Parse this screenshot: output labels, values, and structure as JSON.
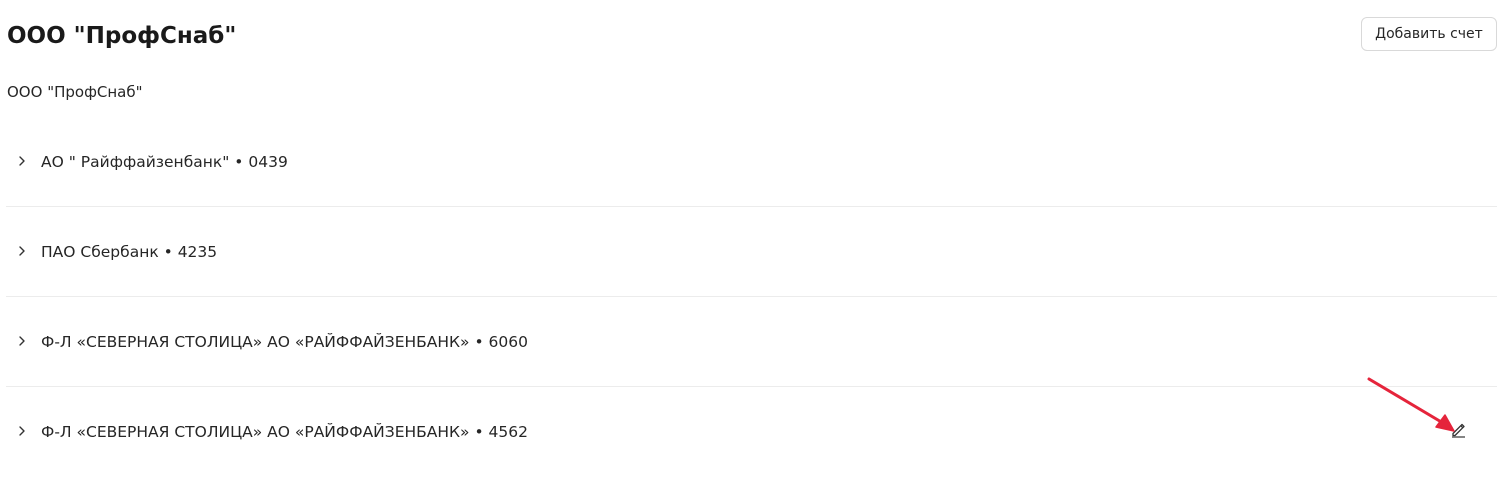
{
  "header": {
    "title": "ООО \"ПрофСнаб\"",
    "add_button_label": "Добавить счет"
  },
  "subtitle": "ООО \"ПрофСнаб\"",
  "accounts": [
    {
      "label": "АО \" Райффайзенбанк\" • 0439",
      "icon": "chevron-right-icon"
    },
    {
      "label": "ПАО Сбербанк • 4235",
      "icon": "chevron-right-icon"
    },
    {
      "label": "Ф-Л «СЕВЕРНАЯ СТОЛИЦА» АО «РАЙФФАЙЗЕНБАНК» • 6060",
      "icon": "chevron-right-icon"
    },
    {
      "label": "Ф-Л «СЕВЕРНАЯ СТОЛИЦА» АО «РАЙФФАЙЗЕНБАНК» • 4562",
      "icon": "chevron-right-icon",
      "action_icon": "pencil-edit-icon"
    }
  ],
  "colors": {
    "text": "#262626",
    "divider": "#ececec",
    "button_border": "#d9d9d9",
    "annotation": "#e5243b"
  }
}
